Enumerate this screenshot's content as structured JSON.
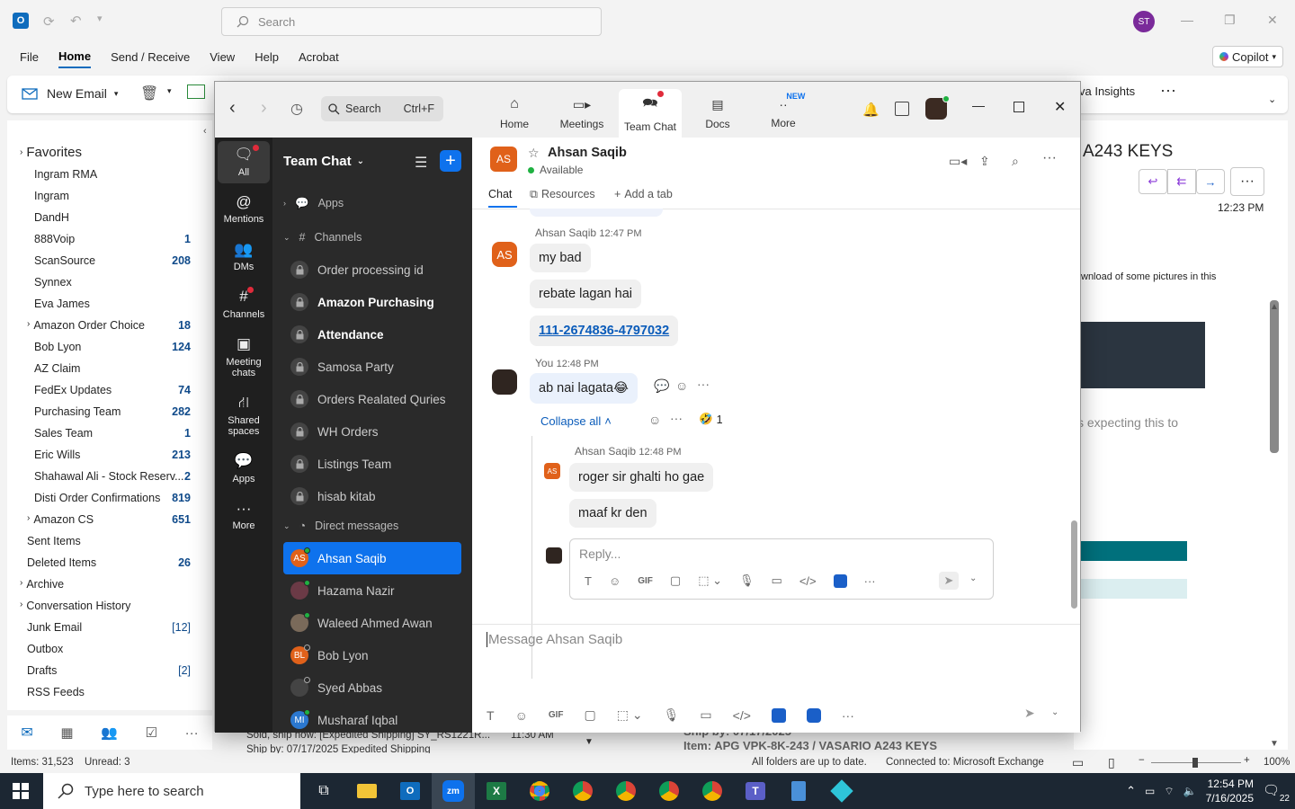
{
  "outlook": {
    "search_placeholder": "Search",
    "avatar_initials": "ST",
    "menu": [
      "File",
      "Home",
      "Send / Receive",
      "View",
      "Help",
      "Acrobat"
    ],
    "copilot_label": "Copilot",
    "new_email_label": "New Email",
    "insights_label": "va Insights",
    "favorites_label": "Favorites",
    "favorites": [
      {
        "label": "Ingram RMA",
        "count": ""
      },
      {
        "label": "Ingram",
        "count": ""
      },
      {
        "label": "DandH",
        "count": ""
      },
      {
        "label": "888Voip",
        "count": "1"
      },
      {
        "label": "ScanSource",
        "count": "208"
      },
      {
        "label": "Synnex",
        "count": ""
      },
      {
        "label": "Eva James",
        "count": ""
      },
      {
        "label": "Amazon Order Choice",
        "count": "18"
      },
      {
        "label": "Bob Lyon",
        "count": "124"
      },
      {
        "label": "AZ Claim",
        "count": ""
      },
      {
        "label": "FedEx Updates",
        "count": "74"
      },
      {
        "label": "Purchasing Team",
        "count": "282"
      },
      {
        "label": "Sales Team",
        "count": "1"
      },
      {
        "label": "Eric Wills",
        "count": "213"
      },
      {
        "label": "Shahawal Ali - Stock Reserv...",
        "count": "2"
      },
      {
        "label": "Disti Order Confirmations",
        "count": "819"
      },
      {
        "label": "Amazon CS",
        "count": "651"
      }
    ],
    "folders": [
      {
        "label": "Sent Items",
        "count": ""
      },
      {
        "label": "Deleted Items",
        "count": "26"
      },
      {
        "label": "Archive",
        "count": ""
      },
      {
        "label": "Conversation History",
        "count": ""
      },
      {
        "label": "Junk Email",
        "count": "[12]"
      },
      {
        "label": "Outbox",
        "count": ""
      },
      {
        "label": "Drafts",
        "count": "[2]"
      },
      {
        "label": "RSS Feeds",
        "count": ""
      }
    ],
    "reading": {
      "subject": "A243 KEYS",
      "time": "12:23 PM",
      "download_note": "wnload of some pictures in this",
      "expecting": "s expecting this to"
    },
    "list_row": {
      "line1": "Sold, ship now: [Expedited Shipping] SY_RS1221R...",
      "line2": "Ship by: 07/17/2025 Expedited Shipping",
      "time": "11:30 AM",
      "item_line1": "Ship by: 07/17/2025",
      "item_line2": "Item: APG VPK-8K-243 / VASARIO A243 KEYS"
    },
    "status": {
      "items": "Items: 31,523",
      "unread": "Unread: 3",
      "sync": "All folders are up to date.",
      "connection": "Connected to: Microsoft Exchange",
      "zoom": "100%"
    }
  },
  "zoom_app": {
    "search_label": "Search",
    "search_shortcut": "Ctrl+F",
    "tabs": [
      "Home",
      "Meetings",
      "Team Chat",
      "Docs",
      "More"
    ],
    "new_badge": "NEW",
    "rail": [
      "All",
      "Mentions",
      "DMs",
      "Channels",
      "Meeting chats",
      "Shared spaces",
      "Apps",
      "More"
    ],
    "sidebar": {
      "title": "Team Chat",
      "apps_label": "Apps",
      "channels_label": "Channels",
      "channels": [
        {
          "name": "Order processing id",
          "bold": false
        },
        {
          "name": "Amazon Purchasing",
          "bold": true
        },
        {
          "name": "Attendance",
          "bold": true
        },
        {
          "name": "Samosa Party",
          "bold": false
        },
        {
          "name": "Orders Realated Quries",
          "bold": false
        },
        {
          "name": "WH Orders",
          "bold": false
        },
        {
          "name": "Listings Team",
          "bold": false
        },
        {
          "name": "hisab kitab",
          "bold": false
        }
      ],
      "dm_label": "Direct messages",
      "dms": [
        {
          "name": "Ahsan Saqib",
          "initials": "AS",
          "color": "#e0611a"
        },
        {
          "name": "Hazama Nazir",
          "initials": "",
          "color": "#6b3a46"
        },
        {
          "name": "Waleed Ahmed Awan",
          "initials": "",
          "color": "#7a6a5a"
        },
        {
          "name": "Bob Lyon",
          "initials": "BL",
          "color": "#e0611a"
        },
        {
          "name": "Syed Abbas",
          "initials": "",
          "color": "#444444"
        },
        {
          "name": "Musharaf Iqbal",
          "initials": "MI",
          "color": "#2b78d0"
        }
      ]
    },
    "chat": {
      "contact": "Ahsan Saqib",
      "contact_initials": "AS",
      "status": "Available",
      "tabs": [
        "Chat",
        "Resources",
        "Add a tab"
      ],
      "messages": {
        "sender1": "Ahsan Saqib",
        "time1": "12:47 PM",
        "m1": "my bad",
        "m2": "rebate lagan hai",
        "m3": "111-2674836-4797032",
        "you": "You",
        "time2": "12:48 PM",
        "m4": "ab nai lagata",
        "collapse": "Collapse all",
        "reaction_count": "1",
        "reply_sender": "Ahsan Saqib",
        "reply_time": "12:48 PM",
        "r1": "roger sir ghalti ho gae",
        "r2": "maaf kr den"
      },
      "reply_placeholder": "Reply...",
      "composer_placeholder": "Message Ahsan Saqib"
    }
  },
  "taskbar": {
    "search_placeholder": "Type here to search",
    "time": "12:54 PM",
    "date": "7/16/2025",
    "notif_count": "22"
  },
  "colors": {
    "zoom_blue": "#0e72ed",
    "outlook_blue": "#0f6cbd",
    "avatar_orange": "#e0611a"
  }
}
